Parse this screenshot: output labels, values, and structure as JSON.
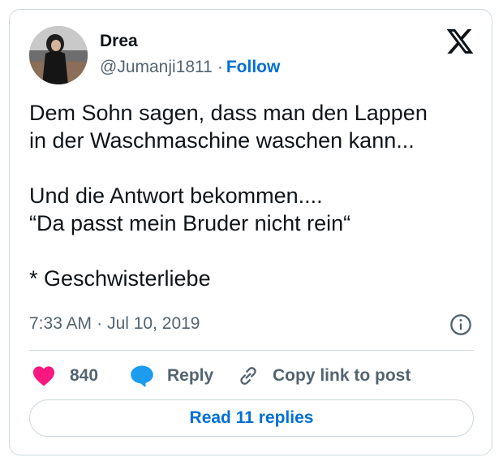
{
  "author": {
    "name": "Drea",
    "handle": "@Jumanji1811",
    "separator": "·",
    "follow_label": "Follow"
  },
  "tweet": {
    "lines": [
      "Dem Sohn sagen, dass man den Lappen",
      "in der Waschmaschine waschen kann...",
      "",
      "Und die Antwort bekommen....",
      "“Da passt mein Bruder nicht rein“",
      "",
      "* Geschwisterliebe"
    ],
    "time": "7:33 AM",
    "meta_separator": "·",
    "date": "Jul 10, 2019"
  },
  "actions": {
    "like_count": "840",
    "reply_label": "Reply",
    "copy_label": "Copy link to post"
  },
  "read_replies_label": "Read 11 replies",
  "icons": {
    "brand": "x-logo-icon",
    "info": "info-icon",
    "like": "heart-icon",
    "reply": "speech-bubble-icon",
    "copy": "link-icon"
  },
  "colors": {
    "heart": "#f91880",
    "reply_bubble": "#1d9bf0",
    "link_blue": "#006fd6",
    "secondary_text": "#536471",
    "border": "#cfd9de"
  }
}
